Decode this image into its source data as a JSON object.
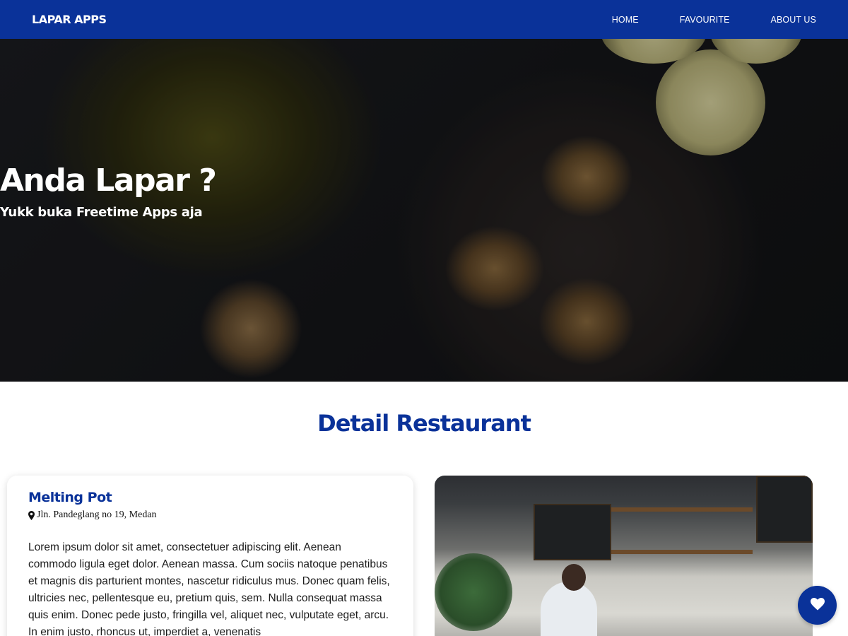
{
  "header": {
    "brand": "LAPAR APPS",
    "nav": [
      {
        "label": "HOME"
      },
      {
        "label": "FAVOURITE"
      },
      {
        "label": "ABOUT US"
      }
    ]
  },
  "hero": {
    "title": "Anda Lapar ?",
    "subtitle": "Yukk buka Freetime Apps aja"
  },
  "section": {
    "title": "Detail Restaurant"
  },
  "restaurant": {
    "name": "Melting Pot",
    "address": "Jln. Pandeglang no 19, Medan",
    "description": "Lorem ipsum dolor sit amet, consectetuer adipiscing elit. Aenean commodo ligula eget dolor. Aenean massa. Cum sociis natoque penatibus et magnis dis parturient montes, nascetur ridiculus mus. Donec quam felis, ultricies nec, pellentesque eu, pretium quis, sem. Nulla consequat massa quis enim. Donec pede justo, fringilla vel, aliquet nec, vulputate eget, arcu. In enim justo, rhoncus ut, imperdiet a, venenatis"
  },
  "icons": {
    "location": "map-pin-icon",
    "favourite": "heart-icon"
  },
  "colors": {
    "primary": "#0a3299",
    "text": "#1c1c1c",
    "white": "#ffffff"
  }
}
